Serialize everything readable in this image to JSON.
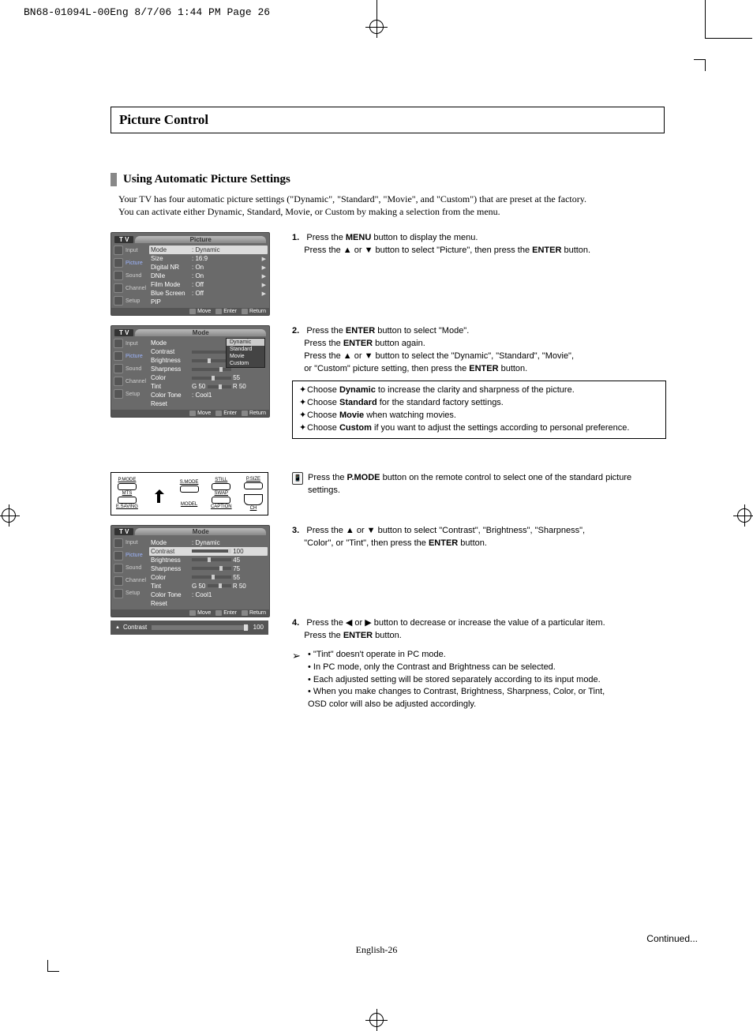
{
  "header": "BN68-01094L-00Eng  8/7/06  1:44 PM  Page 26",
  "title": "Picture Control",
  "section": "Using Automatic Picture Settings",
  "intro1": "Your TV has four automatic picture settings (\"Dynamic\", \"Standard\", \"Movie\", and \"Custom\") that are preset at the factory.",
  "intro2": "You can activate either Dynamic, Standard, Movie, or Custom by making a selection from the menu.",
  "osd": {
    "tv": "T V",
    "side": [
      "Input",
      "Picture",
      "Sound",
      "Channel",
      "Setup"
    ],
    "footer": {
      "move": "Move",
      "enter": "Enter",
      "return": "Return"
    },
    "picture": {
      "title": "Picture",
      "rows": [
        {
          "l": "Mode",
          "v": ": Dynamic",
          "hi": true
        },
        {
          "l": "Size",
          "v": ": 16:9"
        },
        {
          "l": "Digital NR",
          "v": ": On"
        },
        {
          "l": "DNIe",
          "v": ": On"
        },
        {
          "l": "Film Mode",
          "v": ": Off"
        },
        {
          "l": "Blue Screen",
          "v": ": Off"
        },
        {
          "l": "PIP",
          "v": ""
        }
      ]
    },
    "mode1": {
      "title": "Mode",
      "rows": [
        {
          "l": "Mode",
          "v": ""
        },
        {
          "l": "Contrast",
          "v": ""
        },
        {
          "l": "Brightness",
          "v": ""
        },
        {
          "l": "Sharpness",
          "v": ""
        },
        {
          "l": "Color",
          "v": "55"
        },
        {
          "l": "Tint",
          "lv": "G 50",
          "rv": "R 50"
        },
        {
          "l": "Color Tone",
          "v": ": Cool1"
        },
        {
          "l": "Reset",
          "v": ""
        }
      ],
      "popup": [
        "Dynamic",
        "Standard",
        "Movie",
        "Custom"
      ]
    },
    "mode2": {
      "title": "Mode",
      "rows": [
        {
          "l": "Mode",
          "v": ": Dynamic"
        },
        {
          "l": "Contrast",
          "v": "100",
          "hi": true
        },
        {
          "l": "Brightness",
          "v": "45"
        },
        {
          "l": "Sharpness",
          "v": "75"
        },
        {
          "l": "Color",
          "v": "55"
        },
        {
          "l": "Tint",
          "lv": "G 50",
          "rv": "R 50"
        },
        {
          "l": "Color Tone",
          "v": ": Cool1"
        },
        {
          "l": "Reset",
          "v": ""
        }
      ]
    },
    "adjust": {
      "label": "Contrast",
      "value": "100",
      "up": "▲"
    }
  },
  "remote": {
    "pmode": "P.MODE",
    "smode": "S.MODE",
    "still": "STILL",
    "psize": "P.SIZE",
    "mts": "MTS",
    "swap": "SWAP",
    "ch": "CH",
    "esaving": "E.SAVING",
    "model": "MODEL",
    "caption": "CAPTION"
  },
  "steps": {
    "s1a": "Press the ",
    "s1b": "MENU",
    "s1c": " button to display the menu.",
    "s1d": "Press the ▲ or ▼ button to select \"Picture\", then press the ",
    "s1e": "ENTER",
    "s1f": " button.",
    "s2a": "Press the ",
    "s2b": "ENTER",
    "s2c": " button to select \"Mode\".",
    "s2d": "Press the ",
    "s2e": "ENTER",
    "s2f": " button again.",
    "s2g": "Press the ▲ or ▼ button to select the \"Dynamic\", \"Standard\", \"Movie\",",
    "s2h": "or \"Custom\" picture setting, then press the ",
    "s2i": "ENTER",
    "s2j": " button.",
    "box": [
      {
        "pre": "Choose ",
        "b": "Dynamic",
        "post": " to increase the clarity and sharpness of the picture."
      },
      {
        "pre": "Choose ",
        "b": "Standard",
        "post": " for the standard factory settings."
      },
      {
        "pre": "Choose ",
        "b": "Movie",
        "post": " when watching movies."
      },
      {
        "pre": "Choose ",
        "b": "Custom",
        "post": " if you want to adjust the settings according to personal preference."
      }
    ],
    "rnote_a": "Press the ",
    "rnote_b": "P.MODE",
    "rnote_c": " button on the remote control to select one of the standard picture settings.",
    "s3a": "Press the ▲ or ▼ button to select \"Contrast\", \"Brightness\", \"Sharpness\",",
    "s3b": "\"Color\", or \"Tint\", then press the ",
    "s3c": "ENTER",
    "s3d": " button.",
    "s4a": "Press the ◀ or ▶ button to decrease or increase the value of a particular item.",
    "s4b": "Press the ",
    "s4c": "ENTER",
    "s4d": " button.",
    "notes": [
      "• \"Tint\" doesn't operate in PC mode.",
      "• In PC mode, only the Contrast and Brightness can be selected.",
      "• Each adjusted setting will be stored separately according to its input mode.",
      "• When you make changes to Contrast, Brightness, Sharpness, Color, or Tint,",
      "  OSD color will also be adjusted accordingly."
    ],
    "notes_arrow": "➢"
  },
  "continued": "Continued...",
  "pagenum": "English-26",
  "nums": {
    "n1": "1.",
    "n2": "2.",
    "n3": "3.",
    "n4": "4."
  }
}
